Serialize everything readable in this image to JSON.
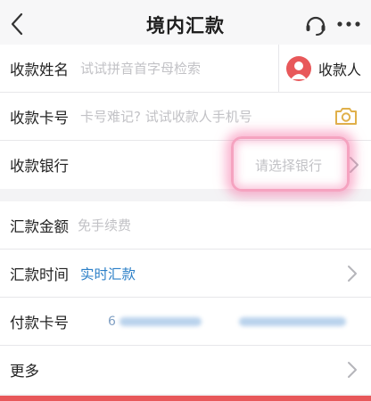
{
  "nav": {
    "title": "境内汇款"
  },
  "form": {
    "payee_name": {
      "label": "收款姓名",
      "placeholder": "试试拼音首字母检索",
      "payee_button": "收款人"
    },
    "card_no": {
      "label": "收款卡号",
      "placeholder": "卡号难记? 试试收款人手机号"
    },
    "bank": {
      "label": "收款银行",
      "placeholder": "请选择银行"
    },
    "amount": {
      "label": "汇款金额",
      "placeholder": "免手续费"
    },
    "time": {
      "label": "汇款时间",
      "value": "实时汇款"
    },
    "pay_card": {
      "label": "付款卡号",
      "value_prefix": "6"
    },
    "more": {
      "label": "更多"
    }
  },
  "colors": {
    "accent_blue": "#2b7fc7",
    "avatar_red": "#e8585a",
    "highlight_pink": "#f5a3c0",
    "camera_gold": "#e0b04a"
  },
  "icons": {
    "back": "chevron-left-icon",
    "service": "headset-icon",
    "more": "more-dots-icon",
    "payee": "person-avatar-icon",
    "camera": "camera-icon",
    "chevron": "chevron-right-icon"
  }
}
